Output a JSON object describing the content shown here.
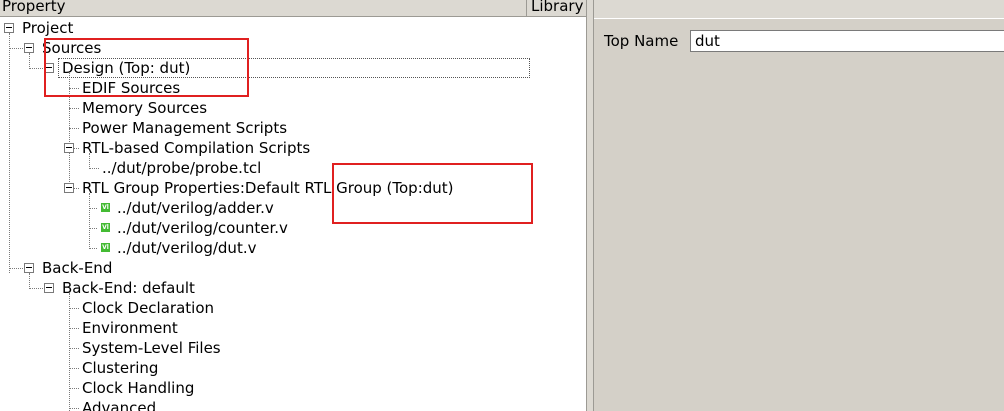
{
  "header": {
    "property_label": "Property",
    "library_label": "Library"
  },
  "tree": {
    "project": "Project",
    "sources": "Sources",
    "design": "Design (Top: dut)",
    "edif_sources": "EDIF Sources",
    "memory_sources": "Memory Sources",
    "power_scripts": "Power Management Scripts",
    "rtl_scripts": "RTL-based Compilation Scripts",
    "probe_tcl": "../dut/probe/probe.tcl",
    "rtl_group": "RTL Group Properties:Default RTL Group (Top:dut)",
    "adder": "../dut/verilog/adder.v",
    "counter": "../dut/verilog/counter.v",
    "dut_v": "../dut/verilog/dut.v",
    "back_end": "Back-End",
    "back_end_default": "Back-End: default",
    "clock_declaration": "Clock Declaration",
    "environment": "Environment",
    "system_level_files": "System-Level Files",
    "clustering": "Clustering",
    "clock_handling": "Clock Handling",
    "advanced": "Advanced",
    "verilog_icon_text": "Vl"
  },
  "properties": {
    "top_name_label": "Top Name",
    "top_name_value": "dut"
  },
  "colors": {
    "highlight_box": "#e02020",
    "panel_bg": "#d4d0c8",
    "verilog_icon": "#44bb33"
  }
}
